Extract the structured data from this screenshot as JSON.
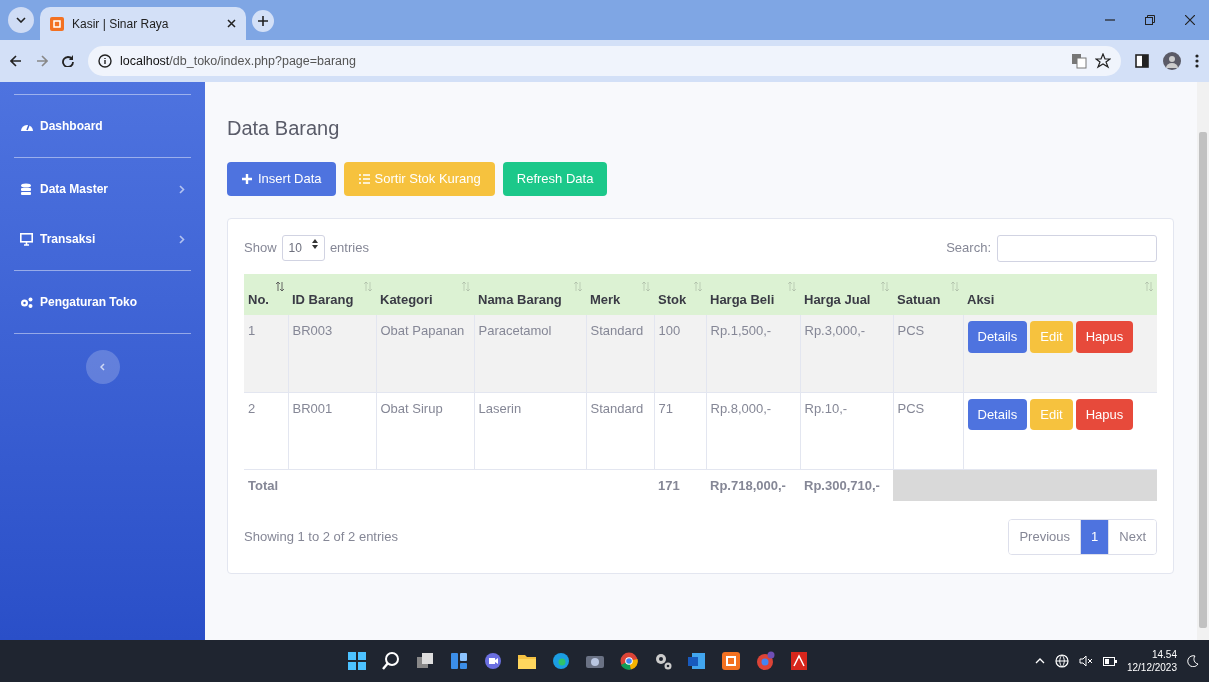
{
  "browser": {
    "tab_title": "Kasir | Sinar Raya",
    "url_host": "localhost",
    "url_path": "/db_toko/index.php?page=barang"
  },
  "sidebar": {
    "sections": [
      [
        {
          "label": "Dashboard",
          "expandable": false
        }
      ],
      [
        {
          "label": "Data Master",
          "expandable": true
        },
        {
          "label": "Transaksi",
          "expandable": true
        }
      ],
      [
        {
          "label": "Pengaturan Toko",
          "expandable": false
        }
      ]
    ]
  },
  "page_title": "Data Barang",
  "toolbar": [
    {
      "label": "Insert Data",
      "kind": "primary"
    },
    {
      "label": "Sortir Stok Kurang",
      "kind": "warning"
    },
    {
      "label": "Refresh Data",
      "kind": "success"
    }
  ],
  "table": {
    "show_label": "Show",
    "page_size": "10",
    "entries_label": "entries",
    "search_label": "Search:",
    "columns": [
      {
        "label": "No.",
        "sorted": true
      },
      {
        "label": "ID Barang",
        "sorted": false
      },
      {
        "label": "Kategori",
        "sorted": false
      },
      {
        "label": "Nama Barang",
        "sorted": false
      },
      {
        "label": "Merk",
        "sorted": false
      },
      {
        "label": "Stok",
        "sorted": false
      },
      {
        "label": "Harga Beli",
        "sorted": false
      },
      {
        "label": "Harga Jual",
        "sorted": false
      },
      {
        "label": "Satuan",
        "sorted": false
      },
      {
        "label": "Aksi",
        "sorted": false
      }
    ],
    "rows": [
      {
        "cells": [
          "1",
          "BR003",
          "Obat Papanan",
          "Paracetamol",
          "Standard",
          "100",
          "Rp.1,500,-",
          "Rp.3,000,-",
          "PCS"
        ],
        "actions": [
          {
            "label": "Details",
            "kind": "primary"
          },
          {
            "label": "Edit",
            "kind": "warning"
          },
          {
            "label": "Hapus",
            "kind": "danger"
          }
        ]
      },
      {
        "cells": [
          "2",
          "BR001",
          "Obat Sirup",
          "Laserin",
          "Standard",
          "71",
          "Rp.8,000,-",
          "Rp.10,-",
          "PCS"
        ],
        "actions": [
          {
            "label": "Details",
            "kind": "primary"
          },
          {
            "label": "Edit",
            "kind": "warning"
          },
          {
            "label": "Hapus",
            "kind": "danger"
          }
        ]
      }
    ],
    "total": {
      "label": "Total",
      "stok": "171",
      "harga_beli": "Rp.718,000,-",
      "harga_jual": "Rp.300,710,-"
    },
    "info": "Showing 1 to 2 of 2 entries",
    "pagination": [
      {
        "label": "Previous",
        "selected": false
      },
      {
        "label": "1",
        "selected": true
      },
      {
        "label": "Next",
        "selected": false
      }
    ]
  },
  "taskbar": {
    "time": "14.54",
    "date": "12/12/2023"
  }
}
